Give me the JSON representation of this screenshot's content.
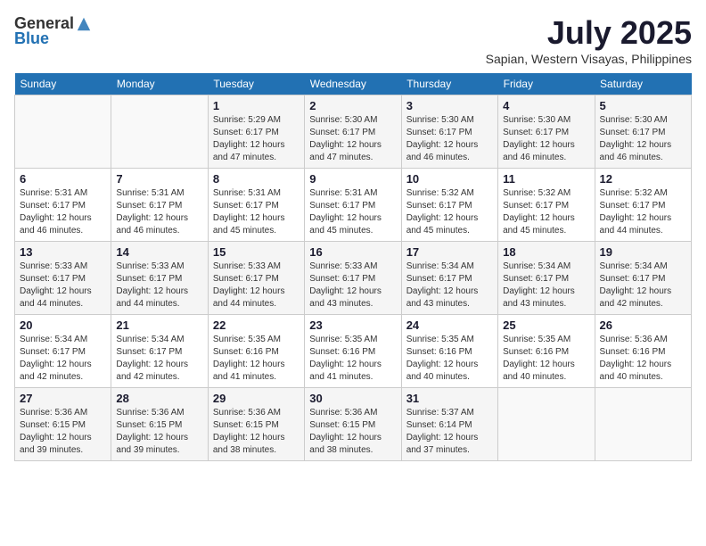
{
  "logo": {
    "general": "General",
    "blue": "Blue"
  },
  "title": {
    "month": "July 2025",
    "location": "Sapian, Western Visayas, Philippines"
  },
  "days_of_week": [
    "Sunday",
    "Monday",
    "Tuesday",
    "Wednesday",
    "Thursday",
    "Friday",
    "Saturday"
  ],
  "weeks": [
    [
      {
        "day": "",
        "sunrise": "",
        "sunset": "",
        "daylight": ""
      },
      {
        "day": "",
        "sunrise": "",
        "sunset": "",
        "daylight": ""
      },
      {
        "day": "1",
        "sunrise": "Sunrise: 5:29 AM",
        "sunset": "Sunset: 6:17 PM",
        "daylight": "Daylight: 12 hours and 47 minutes."
      },
      {
        "day": "2",
        "sunrise": "Sunrise: 5:30 AM",
        "sunset": "Sunset: 6:17 PM",
        "daylight": "Daylight: 12 hours and 47 minutes."
      },
      {
        "day": "3",
        "sunrise": "Sunrise: 5:30 AM",
        "sunset": "Sunset: 6:17 PM",
        "daylight": "Daylight: 12 hours and 46 minutes."
      },
      {
        "day": "4",
        "sunrise": "Sunrise: 5:30 AM",
        "sunset": "Sunset: 6:17 PM",
        "daylight": "Daylight: 12 hours and 46 minutes."
      },
      {
        "day": "5",
        "sunrise": "Sunrise: 5:30 AM",
        "sunset": "Sunset: 6:17 PM",
        "daylight": "Daylight: 12 hours and 46 minutes."
      }
    ],
    [
      {
        "day": "6",
        "sunrise": "Sunrise: 5:31 AM",
        "sunset": "Sunset: 6:17 PM",
        "daylight": "Daylight: 12 hours and 46 minutes."
      },
      {
        "day": "7",
        "sunrise": "Sunrise: 5:31 AM",
        "sunset": "Sunset: 6:17 PM",
        "daylight": "Daylight: 12 hours and 46 minutes."
      },
      {
        "day": "8",
        "sunrise": "Sunrise: 5:31 AM",
        "sunset": "Sunset: 6:17 PM",
        "daylight": "Daylight: 12 hours and 45 minutes."
      },
      {
        "day": "9",
        "sunrise": "Sunrise: 5:31 AM",
        "sunset": "Sunset: 6:17 PM",
        "daylight": "Daylight: 12 hours and 45 minutes."
      },
      {
        "day": "10",
        "sunrise": "Sunrise: 5:32 AM",
        "sunset": "Sunset: 6:17 PM",
        "daylight": "Daylight: 12 hours and 45 minutes."
      },
      {
        "day": "11",
        "sunrise": "Sunrise: 5:32 AM",
        "sunset": "Sunset: 6:17 PM",
        "daylight": "Daylight: 12 hours and 45 minutes."
      },
      {
        "day": "12",
        "sunrise": "Sunrise: 5:32 AM",
        "sunset": "Sunset: 6:17 PM",
        "daylight": "Daylight: 12 hours and 44 minutes."
      }
    ],
    [
      {
        "day": "13",
        "sunrise": "Sunrise: 5:33 AM",
        "sunset": "Sunset: 6:17 PM",
        "daylight": "Daylight: 12 hours and 44 minutes."
      },
      {
        "day": "14",
        "sunrise": "Sunrise: 5:33 AM",
        "sunset": "Sunset: 6:17 PM",
        "daylight": "Daylight: 12 hours and 44 minutes."
      },
      {
        "day": "15",
        "sunrise": "Sunrise: 5:33 AM",
        "sunset": "Sunset: 6:17 PM",
        "daylight": "Daylight: 12 hours and 44 minutes."
      },
      {
        "day": "16",
        "sunrise": "Sunrise: 5:33 AM",
        "sunset": "Sunset: 6:17 PM",
        "daylight": "Daylight: 12 hours and 43 minutes."
      },
      {
        "day": "17",
        "sunrise": "Sunrise: 5:34 AM",
        "sunset": "Sunset: 6:17 PM",
        "daylight": "Daylight: 12 hours and 43 minutes."
      },
      {
        "day": "18",
        "sunrise": "Sunrise: 5:34 AM",
        "sunset": "Sunset: 6:17 PM",
        "daylight": "Daylight: 12 hours and 43 minutes."
      },
      {
        "day": "19",
        "sunrise": "Sunrise: 5:34 AM",
        "sunset": "Sunset: 6:17 PM",
        "daylight": "Daylight: 12 hours and 42 minutes."
      }
    ],
    [
      {
        "day": "20",
        "sunrise": "Sunrise: 5:34 AM",
        "sunset": "Sunset: 6:17 PM",
        "daylight": "Daylight: 12 hours and 42 minutes."
      },
      {
        "day": "21",
        "sunrise": "Sunrise: 5:34 AM",
        "sunset": "Sunset: 6:17 PM",
        "daylight": "Daylight: 12 hours and 42 minutes."
      },
      {
        "day": "22",
        "sunrise": "Sunrise: 5:35 AM",
        "sunset": "Sunset: 6:16 PM",
        "daylight": "Daylight: 12 hours and 41 minutes."
      },
      {
        "day": "23",
        "sunrise": "Sunrise: 5:35 AM",
        "sunset": "Sunset: 6:16 PM",
        "daylight": "Daylight: 12 hours and 41 minutes."
      },
      {
        "day": "24",
        "sunrise": "Sunrise: 5:35 AM",
        "sunset": "Sunset: 6:16 PM",
        "daylight": "Daylight: 12 hours and 40 minutes."
      },
      {
        "day": "25",
        "sunrise": "Sunrise: 5:35 AM",
        "sunset": "Sunset: 6:16 PM",
        "daylight": "Daylight: 12 hours and 40 minutes."
      },
      {
        "day": "26",
        "sunrise": "Sunrise: 5:36 AM",
        "sunset": "Sunset: 6:16 PM",
        "daylight": "Daylight: 12 hours and 40 minutes."
      }
    ],
    [
      {
        "day": "27",
        "sunrise": "Sunrise: 5:36 AM",
        "sunset": "Sunset: 6:15 PM",
        "daylight": "Daylight: 12 hours and 39 minutes."
      },
      {
        "day": "28",
        "sunrise": "Sunrise: 5:36 AM",
        "sunset": "Sunset: 6:15 PM",
        "daylight": "Daylight: 12 hours and 39 minutes."
      },
      {
        "day": "29",
        "sunrise": "Sunrise: 5:36 AM",
        "sunset": "Sunset: 6:15 PM",
        "daylight": "Daylight: 12 hours and 38 minutes."
      },
      {
        "day": "30",
        "sunrise": "Sunrise: 5:36 AM",
        "sunset": "Sunset: 6:15 PM",
        "daylight": "Daylight: 12 hours and 38 minutes."
      },
      {
        "day": "31",
        "sunrise": "Sunrise: 5:37 AM",
        "sunset": "Sunset: 6:14 PM",
        "daylight": "Daylight: 12 hours and 37 minutes."
      },
      {
        "day": "",
        "sunrise": "",
        "sunset": "",
        "daylight": ""
      },
      {
        "day": "",
        "sunrise": "",
        "sunset": "",
        "daylight": ""
      }
    ]
  ]
}
